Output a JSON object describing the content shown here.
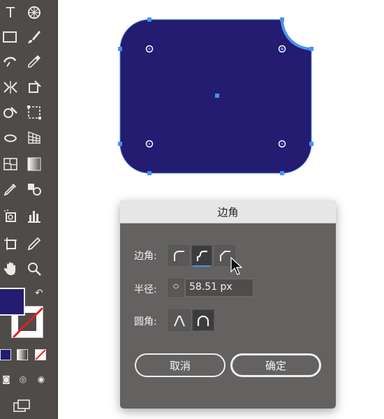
{
  "colors": {
    "shape_fill": "#231c70",
    "selection": "#4a90f0",
    "dialog_bg": "#646161",
    "toolbar_bg": "#4e4b49"
  },
  "toolbar": {
    "tools": [
      {
        "name": "type-tool",
        "glyph": "T"
      },
      {
        "name": "symbol-sprayer-tool",
        "glyph": "⊛"
      },
      {
        "name": "rectangle-tool",
        "glyph": "▭"
      },
      {
        "name": "paintbrush-tool",
        "glyph": "✎"
      },
      {
        "name": "shaper-tool",
        "glyph": "◌"
      },
      {
        "name": "eyedropper-tool",
        "glyph": "✒"
      },
      {
        "name": "width-tool",
        "glyph": "⋈"
      },
      {
        "name": "free-transform-tool",
        "glyph": "⬚"
      },
      {
        "name": "shape-builder-tool",
        "glyph": "✿"
      },
      {
        "name": "perspective-grid-tool",
        "glyph": "▦"
      },
      {
        "name": "mesh-tool",
        "glyph": "⊞"
      },
      {
        "name": "gradient-tool",
        "glyph": "◧"
      },
      {
        "name": "eyedropper-tool-2",
        "glyph": "╱"
      },
      {
        "name": "blend-tool",
        "glyph": "◎"
      },
      {
        "name": "symbol-tool",
        "glyph": "⊡"
      },
      {
        "name": "column-graph-tool",
        "glyph": "▮"
      },
      {
        "name": "artboard-tool",
        "glyph": "⊏"
      },
      {
        "name": "slice-tool",
        "glyph": "✐"
      },
      {
        "name": "hand-tool",
        "glyph": "✋"
      },
      {
        "name": "zoom-tool",
        "glyph": "⌕"
      }
    ]
  },
  "dialog": {
    "title": "边角",
    "corners_label": "边角:",
    "radius_label": "半径:",
    "radius_value": "58.51 px",
    "rounding_label": "圆角:",
    "cancel_label": "取消",
    "ok_label": "确定",
    "corner_types": [
      "round-corner",
      "inverted-corner",
      "chamfer-corner"
    ],
    "selected_corner_index": 1,
    "rounding_types": [
      "absolute-rounding",
      "relative-rounding"
    ],
    "selected_rounding_index": 1
  }
}
